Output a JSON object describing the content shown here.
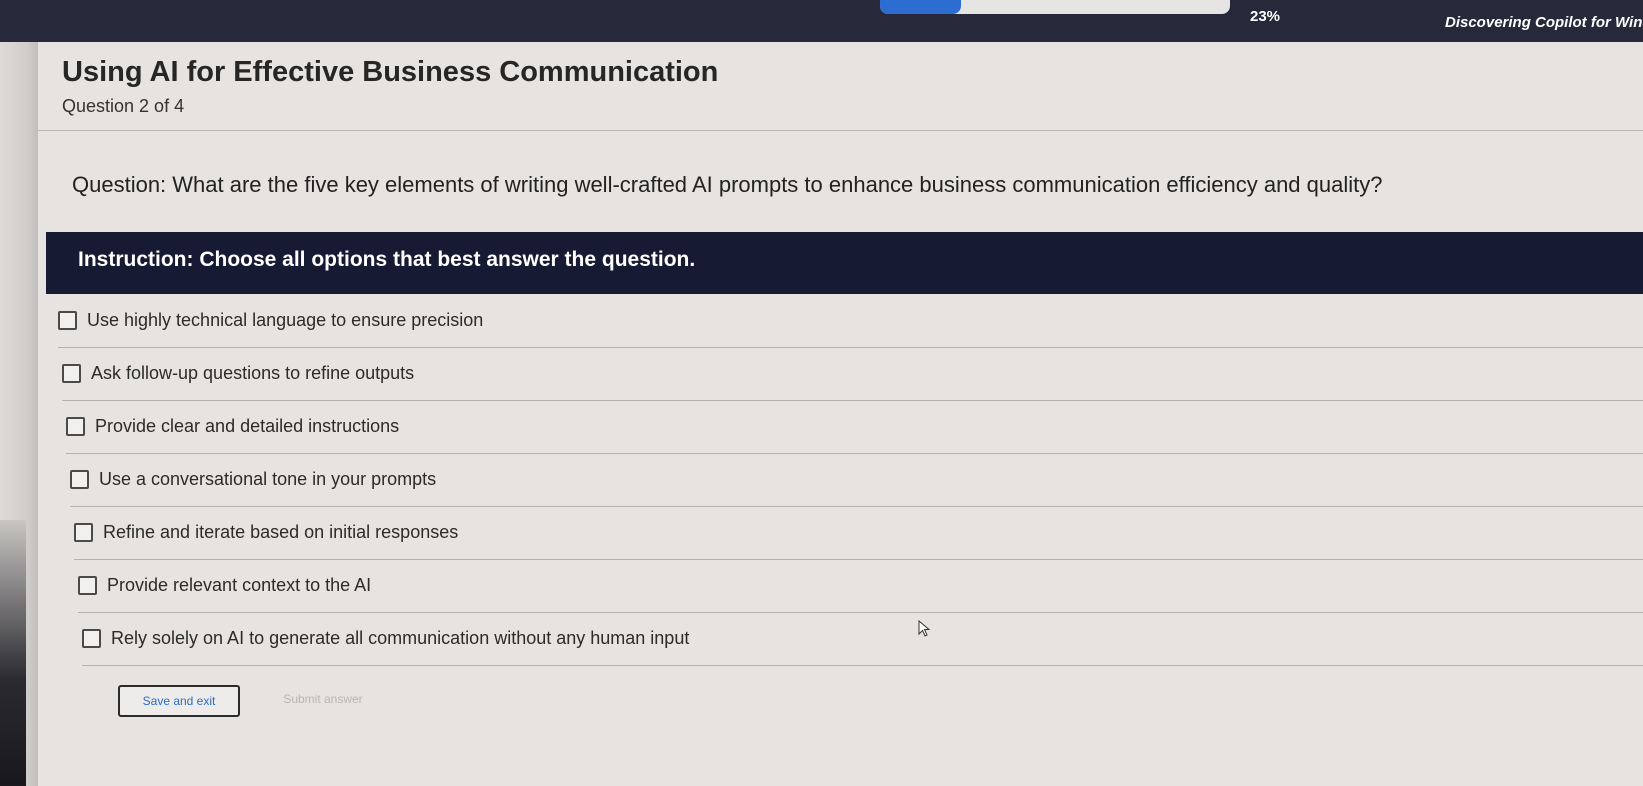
{
  "header": {
    "progress_percent": 23,
    "progress_label": "23%",
    "course_title": "Discovering Copilot for Wind"
  },
  "quiz": {
    "title": "Using AI for Effective Business Communication",
    "question_count": "Question 2 of 4",
    "question": "Question: What are the five key elements of writing well-crafted AI prompts to enhance business communication efficiency and quality?",
    "instruction": "Instruction: Choose all options that best answer the question.",
    "options": [
      {
        "label": "Use highly technical language to ensure precision",
        "checked": false
      },
      {
        "label": "Ask follow-up questions to refine outputs",
        "checked": false
      },
      {
        "label": "Provide clear and detailed instructions",
        "checked": false
      },
      {
        "label": "Use a conversational tone in your prompts",
        "checked": false
      },
      {
        "label": "Refine and iterate based on initial responses",
        "checked": false
      },
      {
        "label": "Provide relevant context to the AI",
        "checked": false
      },
      {
        "label": "Rely solely on AI to generate all communication without any human input",
        "checked": false
      }
    ]
  },
  "actions": {
    "save_label": "Save and exit",
    "submit_label": "Submit answer"
  },
  "colors": {
    "header_bg": "#27293a",
    "progress_fill": "#2d6cd0",
    "instruction_bg": "#161a33",
    "link_blue": "#2b6cc4"
  }
}
